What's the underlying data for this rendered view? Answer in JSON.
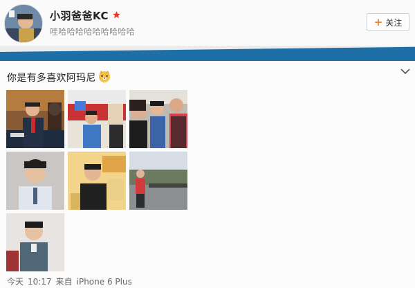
{
  "profile": {
    "username": "小羽爸爸KC",
    "bio": "哇哈哈哈哈哈哈哈哈哈",
    "follow_label": "关注"
  },
  "post": {
    "text": "你是有多喜欢阿玛尼",
    "emoji": "doge-emoji",
    "photos": [
      "photo-1",
      "photo-2",
      "photo-3",
      "photo-4",
      "photo-5",
      "photo-6",
      "photo-7"
    ]
  },
  "footer": {
    "date": "今天",
    "time": "10:17",
    "source_prefix": "来自",
    "source": "iPhone 6 Plus"
  },
  "colors": {
    "accent_orange": "#f08030",
    "band_blue": "#1e6fa6",
    "vip_red": "#e23b2e"
  }
}
